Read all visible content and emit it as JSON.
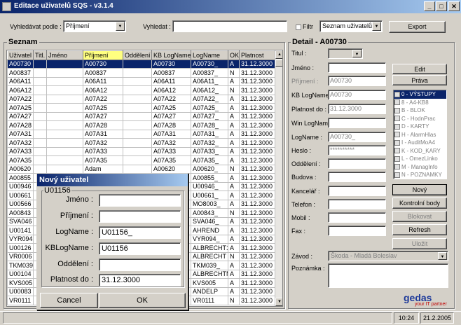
{
  "window": {
    "title": "Editace uživatelů SQS  -  v3.1.4",
    "min": "_",
    "max": "□",
    "close": "✕"
  },
  "toolbar": {
    "search_by_label": "Vyhledávat podle :",
    "search_by_value": "Příjmení",
    "search_label": "Vyhledat :",
    "search_value": "",
    "filter_label": "Filtr",
    "list_select": "Seznam uživatelů",
    "export_label": "Export"
  },
  "list": {
    "title": "Seznam",
    "columns": [
      "Uživatel",
      "Titl.",
      "Jméno",
      "Příjmení",
      "Oddělení",
      "KB LogName",
      "LogName",
      "OK",
      "Platnost"
    ],
    "rows": [
      [
        "A00730",
        "",
        "",
        "A00730",
        "",
        "A00730",
        "A00730_",
        "A",
        "31.12.3000"
      ],
      [
        "A00837",
        "",
        "",
        "A00837",
        "",
        "A00837",
        "A00837_",
        "N",
        "31.12.3000"
      ],
      [
        "A06A11",
        "",
        "",
        "A06A11",
        "",
        "A06A11",
        "A06A11_",
        "A",
        "31.12.3000"
      ],
      [
        "A06A12",
        "",
        "",
        "A06A12",
        "",
        "A06A12",
        "A06A12_",
        "N",
        "31.12.3000"
      ],
      [
        "A07A22",
        "",
        "",
        "A07A22",
        "",
        "A07A22",
        "A07A22_",
        "A",
        "31.12.3000"
      ],
      [
        "A07A25",
        "",
        "",
        "A07A25",
        "",
        "A07A25",
        "A07A25_",
        "A",
        "31.12.3000"
      ],
      [
        "A07A27",
        "",
        "",
        "A07A27",
        "",
        "A07A27",
        "A07A27_",
        "A",
        "31.12.3000"
      ],
      [
        "A07A28",
        "",
        "",
        "A07A28",
        "",
        "A07A28",
        "A07A28_",
        "A",
        "31.12.3000"
      ],
      [
        "A07A31",
        "",
        "",
        "A07A31",
        "",
        "A07A31",
        "A07A31_",
        "A",
        "31.12.3000"
      ],
      [
        "A07A32",
        "",
        "",
        "A07A32",
        "",
        "A07A32",
        "A07A32_",
        "A",
        "31.12.3000"
      ],
      [
        "A07A33",
        "",
        "",
        "A07A33",
        "",
        "A07A33",
        "A07A33_",
        "A",
        "31.12.3000"
      ],
      [
        "A07A35",
        "",
        "",
        "A07A35",
        "",
        "A07A35",
        "A07A35_",
        "A",
        "31.12.3000"
      ],
      [
        "A00620",
        "",
        "",
        "Adam",
        "",
        "A00620",
        "A00620_",
        "N",
        "31.12.3000"
      ],
      [
        "A00855",
        "",
        "",
        "",
        "",
        "",
        "A00855_",
        "A",
        "31.12.3000"
      ],
      [
        "U00946",
        "",
        "",
        "",
        "",
        "",
        "U00946_",
        "A",
        "31.12.3000"
      ],
      [
        "U00661",
        "",
        "",
        "",
        "",
        "",
        "U00661_",
        "A",
        "31.12.3000"
      ],
      [
        "U00566",
        "",
        "",
        "",
        "",
        "",
        "MO8003_",
        "A",
        "31.12.3000"
      ],
      [
        "A00843",
        "",
        "",
        "",
        "",
        "",
        "A00843_",
        "N",
        "31.12.3000"
      ],
      [
        "SVA046",
        "",
        "",
        "",
        "",
        "",
        "SVA046_",
        "A",
        "31.12.3000"
      ],
      [
        "U00141",
        "",
        "",
        "",
        "",
        "",
        "AHREND",
        "A",
        "31.12.3000"
      ],
      [
        "VYR094",
        "",
        "",
        "",
        "",
        "",
        "VYR094_",
        "A",
        "31.12.3000"
      ],
      [
        "U00126",
        "",
        "",
        "",
        "",
        "",
        "ALBRECHT1",
        "A",
        "31.12.3000"
      ],
      [
        "VR0006",
        "",
        "",
        "",
        "",
        "",
        "ALBRECHT",
        "N",
        "31.12.3000"
      ],
      [
        "TKM039",
        "",
        "",
        "",
        "",
        "",
        "TKM039_",
        "A",
        "31.12.3000"
      ],
      [
        "U00104",
        "",
        "",
        "",
        "",
        "",
        "ALBRECHTM",
        "A",
        "31.12.3000"
      ],
      [
        "KVS005",
        "",
        "",
        "",
        "",
        "",
        "KVS005",
        "A",
        "31.12.3000"
      ],
      [
        "U00083",
        "",
        "",
        "",
        "",
        "",
        "ANDELP",
        "A",
        "31.12.3000"
      ],
      [
        "VR0111",
        "",
        "",
        "",
        "",
        "",
        "VR0111",
        "N",
        "31.12.3000"
      ]
    ]
  },
  "detail": {
    "title": "Detail - A00730",
    "titul_label": "Titul :",
    "jmeno_label": "Jméno :",
    "prijmeni_label": "Příjmení :",
    "prijmeni_value": "A00730",
    "kblog_label": "KB LogName :",
    "kblog_value": "A00730",
    "platnost_label": "Platnost do :",
    "platnost_value": "31.12.3000",
    "winlog_label": "Win LogName :",
    "logname_label": "LogName :",
    "logname_value": "A00730_",
    "heslo_label": "Heslo :",
    "heslo_value": "**********",
    "oddeleni_label": "Oddělení :",
    "budova_label": "Budova :",
    "kancelar_label": "Kancelář :",
    "telefon_label": "Telefon :",
    "mobil_label": "Mobil :",
    "fax_label": "Fax :",
    "zavod_label": "Závod :",
    "zavod_value": "Škoda - Mladá Boleslav",
    "poznamka_label": "Poznámka :",
    "edit_btn": "Edit",
    "prava_btn": "Práva",
    "novy_btn": "Nový",
    "kontrolni_btn": "Kontrolní body",
    "blokovat_btn": "Blokovat",
    "refresh_btn": "Refresh",
    "ulozit_btn": "Uložit",
    "rights": [
      "0 - VÝSTUPY",
      "8 - A4-KB8",
      "B - BLOK",
      "C - HodnPrac",
      "D - KARTY",
      "H - AlarmHlas",
      "I - AuditMoA4",
      "K - KOD_KARY",
      "L - OmezLinko",
      "M - ManagInfo",
      "N - POZNAMKY"
    ]
  },
  "dialog": {
    "title": "Nový uživatel",
    "group": "U01156",
    "jmeno_label": "Jméno :",
    "jmeno_value": "",
    "prijmeni_label": "Příjmení :",
    "prijmeni_value": "",
    "logname_label": "LogName :",
    "logname_value": "U01156_",
    "kblog_label": "KBLogName :",
    "kblog_value": "U01156",
    "oddeleni_label": "Oddělení :",
    "oddeleni_value": "",
    "platnost_label": "Platnost do :",
    "platnost_value": "31.12.3000",
    "cancel": "Cancel",
    "ok": "OK"
  },
  "brand": {
    "name": "gedas",
    "tagline": "your IT partner"
  },
  "status": {
    "time": "10:24",
    "date": "21.2.2005"
  }
}
